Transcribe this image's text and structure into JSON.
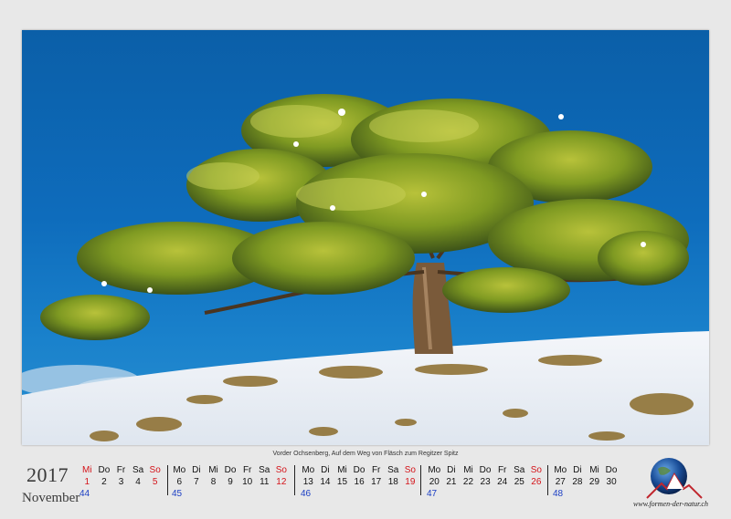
{
  "photo": {
    "description_icon": "tree-photo"
  },
  "caption": "Vorder Ochsenberg, Auf dem Weg von Fläsch zum Regitzer Spitz",
  "calendar": {
    "year": "2017",
    "month": "November",
    "weeks": [
      {
        "days": [
          "Mi",
          "Do",
          "Fr",
          "Sa",
          "So"
        ],
        "dates": [
          "1",
          "2",
          "3",
          "4",
          "5"
        ],
        "week_number": "44"
      },
      {
        "days": [
          "Mo",
          "Di",
          "Mi",
          "Do",
          "Fr",
          "Sa",
          "So"
        ],
        "dates": [
          "6",
          "7",
          "8",
          "9",
          "10",
          "11",
          "12"
        ],
        "week_number": "45"
      },
      {
        "days": [
          "Mo",
          "Di",
          "Mi",
          "Do",
          "Fr",
          "Sa",
          "So"
        ],
        "dates": [
          "13",
          "14",
          "15",
          "16",
          "17",
          "18",
          "19"
        ],
        "week_number": "46"
      },
      {
        "days": [
          "Mo",
          "Di",
          "Mi",
          "Do",
          "Fr",
          "Sa",
          "So"
        ],
        "dates": [
          "20",
          "21",
          "22",
          "23",
          "24",
          "25",
          "26"
        ],
        "week_number": "47"
      },
      {
        "days": [
          "Mo",
          "Di",
          "Mi",
          "Do"
        ],
        "dates": [
          "27",
          "28",
          "29",
          "30"
        ],
        "week_number": "48"
      }
    ]
  },
  "logo": {
    "text": "www.formen-der-natur.ch",
    "icon": "globe-mountain-logo"
  },
  "colors": {
    "sunday_red": "#d4141a",
    "week_blue": "#1c3fc4",
    "sky": "#0e6cbc"
  }
}
